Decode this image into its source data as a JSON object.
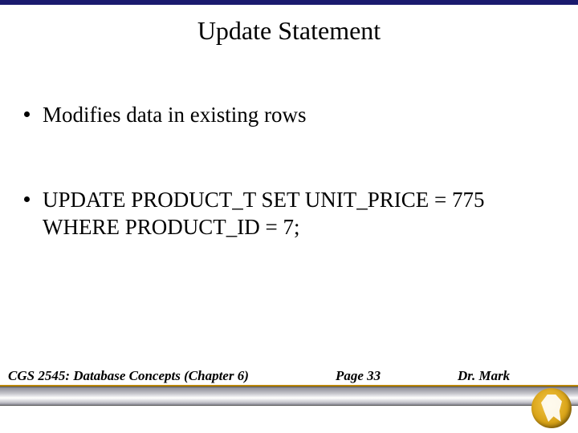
{
  "slide": {
    "title": "Update Statement",
    "bullets": [
      "Modifies data in existing rows",
      "UPDATE PRODUCT_T SET UNIT_PRICE = 775 WHERE PRODUCT_ID = 7;"
    ]
  },
  "footer": {
    "course": "CGS 2545: Database Concepts  (Chapter 6)",
    "page": "Page 33",
    "author": "Dr. Mark"
  }
}
